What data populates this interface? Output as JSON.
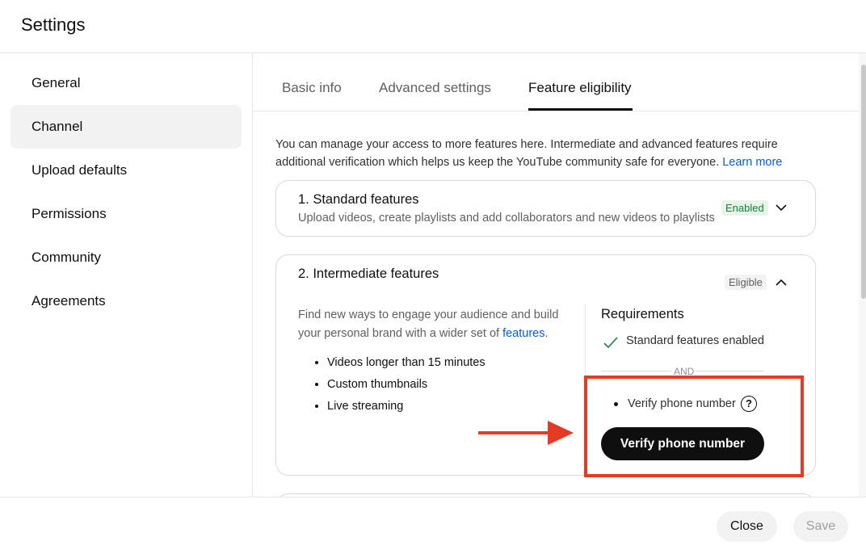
{
  "dialog": {
    "title": "Settings"
  },
  "sidebar": {
    "items": [
      {
        "label": "General"
      },
      {
        "label": "Channel"
      },
      {
        "label": "Upload defaults"
      },
      {
        "label": "Permissions"
      },
      {
        "label": "Community"
      },
      {
        "label": "Agreements"
      }
    ],
    "active": "Channel"
  },
  "tabs": [
    {
      "label": "Basic info"
    },
    {
      "label": "Advanced settings"
    },
    {
      "label": "Feature eligibility"
    }
  ],
  "active_tab": "Feature eligibility",
  "intro": {
    "text": "You can manage your access to more features here. Intermediate and advanced features require additional verification which helps us keep the YouTube community safe for everyone.",
    "link": "Learn more"
  },
  "standard_card": {
    "title": "1. Standard features",
    "subtitle": "Upload videos, create playlists and add collaborators and new videos to playlists",
    "badge": "Enabled"
  },
  "intermediate_card": {
    "title": "2. Intermediate features",
    "badge": "Eligible",
    "description": "Find new ways to engage your audience and build your personal brand with a wider set of",
    "description_link": "features",
    "bullets": [
      "Videos longer than 15 minutes",
      "Custom thumbnails",
      "Live streaming"
    ],
    "requirements": {
      "title": "Requirements",
      "item_done": "Standard features enabled",
      "and": "AND",
      "item_pending": "Verify phone number",
      "button": "Verify phone number"
    }
  },
  "footer": {
    "close": "Close",
    "save": "Save"
  },
  "colors": {
    "accent_link": "#065fd4",
    "enabled_badge": "#188038",
    "annotation": "#e53a24",
    "primary_button": "#0f0f0f"
  },
  "icons": {
    "expand": "chevron-down-icon",
    "collapse": "chevron-up-icon",
    "done": "check-icon",
    "help": "help-icon",
    "annotation": "arrow-right-icon"
  }
}
